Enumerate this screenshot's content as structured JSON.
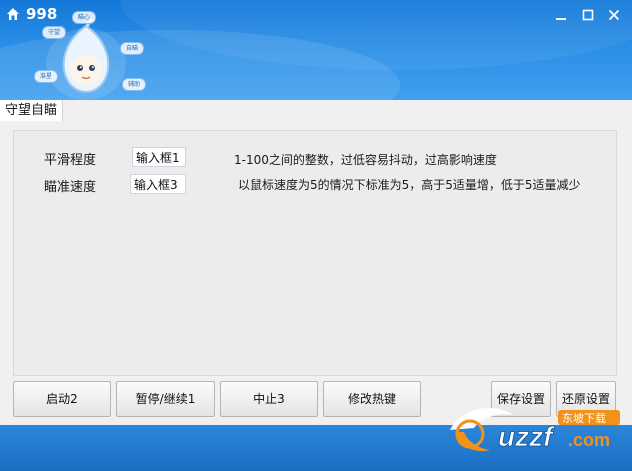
{
  "window": {
    "title": "998",
    "icons": {
      "app": "home-icon",
      "minimize": "minimize-icon",
      "maximize": "maximize-icon",
      "close": "close-icon"
    }
  },
  "header": {
    "mascot_bubbles": [
      "守望",
      "瞄心",
      "自瞄",
      "辅助",
      "准星"
    ]
  },
  "tabs": [
    {
      "label": "守望自瞄",
      "active": true
    }
  ],
  "settings": {
    "smoothing": {
      "label": "平滑程度",
      "value": "输入框1",
      "description": "1-100之间的整数，过低容易抖动，过高影响速度"
    },
    "aim_speed": {
      "label": "瞄准速度",
      "value": "输入框3",
      "description": "以鼠标速度为5的情况下标准为5，高于5适量增，低于5适量减少"
    }
  },
  "buttons": {
    "start": "启动2",
    "pause": "暂停/继续1",
    "stop": "中止3",
    "hotkey": "修改热键",
    "save": "保存设置",
    "restore": "还原设置"
  },
  "watermark": {
    "site": "uzzf",
    "suffix": ".com",
    "tagline": "东坡下载"
  },
  "colors": {
    "titlebar": "#1378d8",
    "content_bg": "#f0f0f0",
    "bottombar": "#1b6fc2",
    "watermark_orange": "#f29219"
  }
}
